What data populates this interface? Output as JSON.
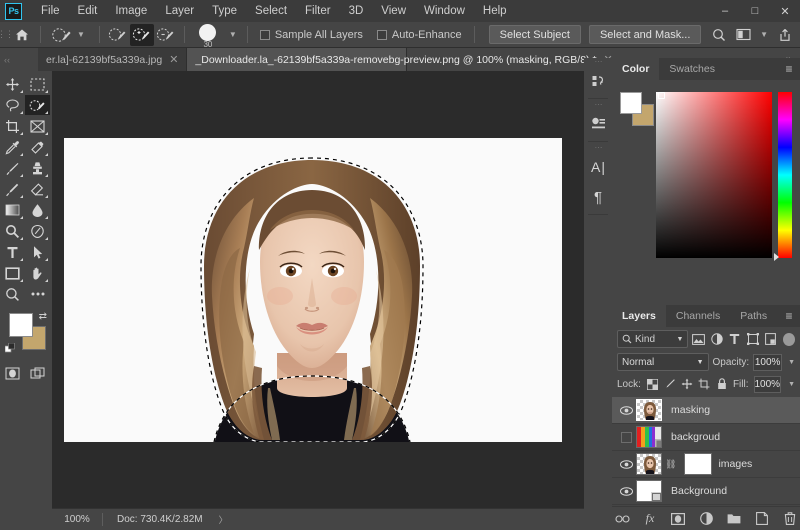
{
  "app": {
    "logo": "Ps"
  },
  "menu": {
    "items": [
      {
        "label": "File"
      },
      {
        "label": "Edit"
      },
      {
        "label": "Image"
      },
      {
        "label": "Layer"
      },
      {
        "label": "Type"
      },
      {
        "label": "Select"
      },
      {
        "label": "Filter"
      },
      {
        "label": "3D"
      },
      {
        "label": "View"
      },
      {
        "label": "Window"
      },
      {
        "label": "Help"
      }
    ]
  },
  "window_controls": {
    "minimize": "–",
    "maximize": "□",
    "close": "✕"
  },
  "options_bar": {
    "brush_size": "30",
    "sample_all_layers": {
      "label": "Sample All Layers",
      "checked": false
    },
    "auto_enhance": {
      "label": "Auto-Enhance",
      "checked": false
    },
    "select_subject": "Select Subject",
    "select_and_mask": "Select and Mask..."
  },
  "tabs": {
    "items": [
      {
        "label": "er.la]-62139bf5a339a.jpg",
        "active": false,
        "close": "✕"
      },
      {
        "label": "_Downloader.la_-62139bf5a339a-removebg-preview.png @ 100% (masking, RGB/8) *",
        "active": true,
        "close": "✕"
      }
    ],
    "overflow": "»"
  },
  "toolbar": {
    "tools": [
      {
        "name": "move-tool",
        "active": false
      },
      {
        "name": "rectangular-marquee-tool",
        "active": false
      },
      {
        "name": "lasso-tool",
        "active": false
      },
      {
        "name": "quick-selection-tool",
        "active": true
      },
      {
        "name": "crop-tool",
        "active": false
      },
      {
        "name": "frame-tool",
        "active": false
      },
      {
        "name": "eyedropper-tool",
        "active": false
      },
      {
        "name": "spot-healing-brush-tool",
        "active": false
      },
      {
        "name": "brush-tool",
        "active": false
      },
      {
        "name": "clone-stamp-tool",
        "active": false
      },
      {
        "name": "history-brush-tool",
        "active": false
      },
      {
        "name": "eraser-tool",
        "active": false
      },
      {
        "name": "gradient-tool",
        "active": false
      },
      {
        "name": "blur-tool",
        "active": false
      },
      {
        "name": "dodge-tool",
        "active": false
      },
      {
        "name": "pen-tool",
        "active": false
      },
      {
        "name": "type-tool",
        "active": false
      },
      {
        "name": "path-selection-tool",
        "active": false
      },
      {
        "name": "rectangle-tool",
        "active": false
      },
      {
        "name": "hand-tool",
        "active": false
      },
      {
        "name": "zoom-tool",
        "active": false
      },
      {
        "name": "edit-toolbar-tool",
        "active": false
      }
    ],
    "foreground_color": "#ffffff",
    "background_color": "#c3a66d"
  },
  "status_bar": {
    "zoom": "100%",
    "doc_info": "Doc: 730.4K/2.82M",
    "arrow": "〉"
  },
  "rail": {
    "buttons": [
      {
        "name": "history-panel-icon"
      },
      {
        "name": "adjustments-panel-icon"
      },
      {
        "name": "character-panel-icon",
        "glyph": "A"
      },
      {
        "name": "paragraph-panel-icon",
        "glyph": "¶"
      }
    ]
  },
  "color_panel": {
    "tabs": [
      {
        "label": "Color",
        "active": true
      },
      {
        "label": "Swatches",
        "active": false
      }
    ],
    "menu": "≡",
    "foreground_color": "#ffffff",
    "background_color": "#c3a66d",
    "field_hue": "#ff0000"
  },
  "layers_panel": {
    "tabs": [
      {
        "label": "Layers",
        "active": true
      },
      {
        "label": "Channels",
        "active": false
      },
      {
        "label": "Paths",
        "active": false
      }
    ],
    "menu": "≡",
    "filter_kind": "Kind",
    "filter_icons": [
      "image-filter-icon",
      "adjustment-filter-icon",
      "type-filter-icon",
      "shape-filter-icon",
      "smart-object-filter-icon"
    ],
    "blend_mode": "Normal",
    "opacity_label": "Opacity:",
    "opacity_value": "100%",
    "lock_label": "Lock:",
    "lock_icons": [
      "lock-transparent-pixels-icon",
      "lock-image-pixels-icon",
      "lock-position-icon",
      "lock-artboard-icon",
      "lock-all-icon"
    ],
    "fill_label": "Fill:",
    "fill_value": "100%",
    "layers": [
      {
        "name": "masking",
        "visible": true,
        "selected": true,
        "thumb": "portrait-transparent",
        "has_mask": false
      },
      {
        "name": "backgroud",
        "visible": false,
        "selected": false,
        "thumb": "colorful-gradient",
        "has_mask": false
      },
      {
        "name": "images",
        "visible": true,
        "selected": false,
        "thumb": "portrait-transparent",
        "has_mask": true
      },
      {
        "name": "Background",
        "visible": true,
        "selected": false,
        "thumb": "white",
        "has_mask": false
      }
    ],
    "bottom_buttons": [
      {
        "name": "link-layers-button",
        "glyph": "∞"
      },
      {
        "name": "layer-style-button",
        "glyph": "fx"
      },
      {
        "name": "add-layer-mask-button",
        "glyph": "▣"
      },
      {
        "name": "new-adjustment-layer-button",
        "glyph": "◑"
      },
      {
        "name": "new-group-button",
        "glyph": "▰"
      },
      {
        "name": "new-layer-button",
        "glyph": "⧉"
      },
      {
        "name": "delete-layer-button",
        "glyph": "Ὕ1"
      }
    ]
  }
}
